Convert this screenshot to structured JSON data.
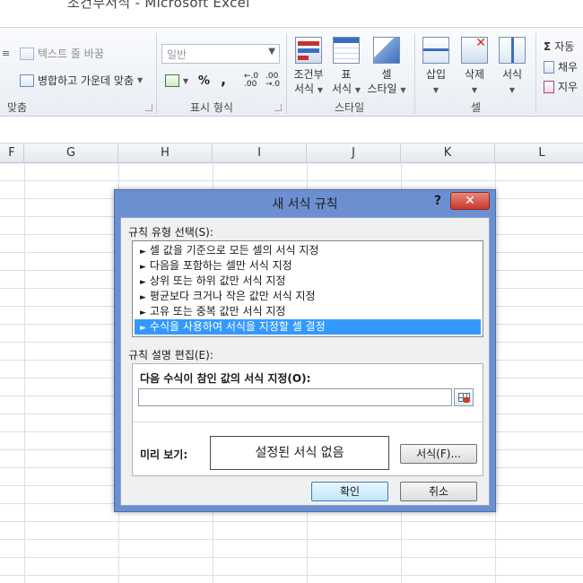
{
  "window": {
    "title": "조건부서식 - Microsoft Excel"
  },
  "ribbon": {
    "alignment": {
      "wrap_text": "텍스트 줄 바꿈",
      "merge_center": "병합하고 가운데 맞춤",
      "group_label": "맞춤"
    },
    "number": {
      "format_value": "일반",
      "percent": "%",
      "comma": ",",
      "increase_decimal": "←.0\n.00",
      "decrease_decimal": ".00\n→.0",
      "group_label": "표시 형식"
    },
    "styles": {
      "conditional_line1": "조건부",
      "conditional_line2": "서식",
      "table_line1": "표",
      "table_line2": "서식",
      "cell_line1": "셀",
      "cell_line2": "스타일",
      "group_label": "스타일"
    },
    "cells": {
      "insert": "삽입",
      "delete": "삭제",
      "format": "서식",
      "group_label": "셀"
    },
    "editing": {
      "autosum": "자동",
      "fill": "채우",
      "clear": "지우",
      "sigma": "Σ"
    }
  },
  "grid": {
    "columns": [
      "F",
      "G",
      "H",
      "I",
      "J",
      "K",
      "L"
    ]
  },
  "dialog": {
    "title": "새 서식 규칙",
    "help": "?",
    "close": "✕",
    "rule_type_label": "규칙 유형 선택(S):",
    "rule_types": [
      "셀 값을 기준으로 모든 셀의 서식 지정",
      "다음을 포함하는 셀만 서식 지정",
      "상위 또는 하위 값만 서식 지정",
      "평균보다 크거나 작은 값만 서식 지정",
      "고유 또는 중복 값만 서식 지정",
      "수식을 사용하여 서식을 지정할 셀 결정"
    ],
    "selected_index": 5,
    "rule_desc_label": "규칙 설명 편집(E):",
    "formula_label": "다음 수식이 참인 값의 서식 지정(O):",
    "formula_value": "",
    "preview_label": "미리 보기:",
    "preview_text": "설정된 서식 없음",
    "format_button": "서식(F)...",
    "ok_button": "확인",
    "cancel_button": "취소"
  },
  "colors": {
    "dialog_frame": "#6b8fd1",
    "selection": "#3399ff",
    "close_button": "#c8392b"
  }
}
